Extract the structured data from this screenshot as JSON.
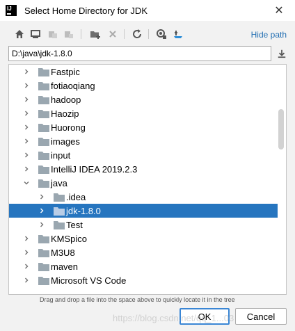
{
  "window": {
    "title": "Select Home Directory for JDK",
    "close_glyph": "✕"
  },
  "app_icon": {
    "text": "IJ"
  },
  "toolbar": {
    "icons": [
      "home-icon",
      "desktop-icon",
      "project-icon",
      "module-icon",
      "new-folder-icon",
      "delete-icon",
      "refresh-icon",
      "show-hidden-icon",
      "jdk-icon"
    ],
    "hide_path_label": "Hide path"
  },
  "path": {
    "value": "D:\\java\\jdk-1.8.0"
  },
  "tree": {
    "items": [
      {
        "label": "Fastpic",
        "expanded": false,
        "selected": false,
        "level": 1
      },
      {
        "label": "fotiaoqiang",
        "expanded": false,
        "selected": false,
        "level": 1
      },
      {
        "label": "hadoop",
        "expanded": false,
        "selected": false,
        "level": 1
      },
      {
        "label": "Haozip",
        "expanded": false,
        "selected": false,
        "level": 1
      },
      {
        "label": "Huorong",
        "expanded": false,
        "selected": false,
        "level": 1
      },
      {
        "label": "images",
        "expanded": false,
        "selected": false,
        "level": 1
      },
      {
        "label": "input",
        "expanded": false,
        "selected": false,
        "level": 1
      },
      {
        "label": "IntelliJ IDEA 2019.2.3",
        "expanded": false,
        "selected": false,
        "level": 1
      },
      {
        "label": "java",
        "expanded": true,
        "selected": false,
        "level": 1
      },
      {
        "label": ".idea",
        "expanded": false,
        "selected": false,
        "level": 2
      },
      {
        "label": "jdk-1.8.0",
        "expanded": false,
        "selected": true,
        "level": 2
      },
      {
        "label": "Test",
        "expanded": false,
        "selected": false,
        "level": 2
      },
      {
        "label": "KMSpico",
        "expanded": false,
        "selected": false,
        "level": 1
      },
      {
        "label": "M3U8",
        "expanded": false,
        "selected": false,
        "level": 1
      },
      {
        "label": "maven",
        "expanded": false,
        "selected": false,
        "level": 1
      },
      {
        "label": "Microsoft VS Code",
        "expanded": false,
        "selected": false,
        "level": 1
      }
    ]
  },
  "hint": "Drag and drop a file into the space above to quickly locate it in the tree",
  "buttons": {
    "ok": "OK",
    "cancel": "Cancel"
  },
  "watermark": "https://blog.csdn.net/qq_1...03",
  "colors": {
    "selection": "#2675bf",
    "link": "#2470b3",
    "folder": "#9aa7b0"
  }
}
